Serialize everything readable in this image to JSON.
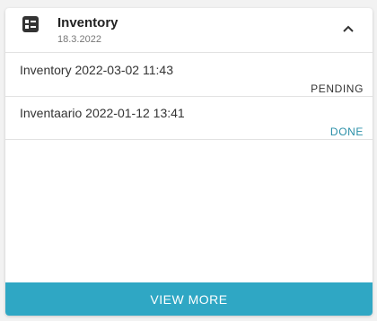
{
  "card": {
    "title": "Inventory",
    "date": "18.3.2022",
    "header_icon": "list-icon",
    "toggle_icon": "chevron-up-icon"
  },
  "items": [
    {
      "title": "Inventory 2022-03-02 11:43",
      "status": "PENDING",
      "status_color": "#333333"
    },
    {
      "title": "Inventaario 2022-01-12 13:41",
      "status": "DONE",
      "status_color": "#2a8fa8"
    }
  ],
  "footer": {
    "view_more_label": "VIEW MORE",
    "accent": "#2fa7c4"
  }
}
